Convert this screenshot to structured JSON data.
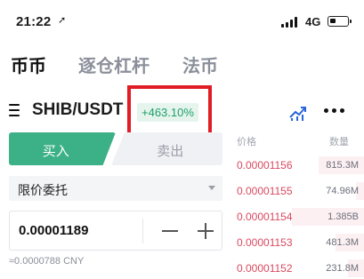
{
  "status_bar": {
    "time": "21:22",
    "location_arrow": "➚",
    "network": "4G"
  },
  "tabs": [
    {
      "label": "币币",
      "active": true
    },
    {
      "label": "逐仓杠杆",
      "active": false
    },
    {
      "label": "法币",
      "active": false
    }
  ],
  "pair": {
    "symbol": "SHIB/USDT",
    "change": "+463.10%",
    "change_color": "#1f9f6a"
  },
  "trade": {
    "buy_label": "买入",
    "sell_label": "卖出",
    "buy_color": "#3cb187",
    "order_type": "限价委托",
    "price_value": "0.00001189",
    "approx_value": "≈0.0000788 CNY"
  },
  "order_book": {
    "price_header": "价格",
    "qty_header": "数量",
    "ask_color": "#d9485f",
    "rows": [
      {
        "price": "0.00001156",
        "qty": "815.3M",
        "depth": 0.35
      },
      {
        "price": "0.00001155",
        "qty": "74.96M",
        "depth": 0.06
      },
      {
        "price": "0.00001154",
        "qty": "1.385B",
        "depth": 0.55
      },
      {
        "price": "0.00001153",
        "qty": "481.3M",
        "depth": 0.22
      },
      {
        "price": "0.00001152",
        "qty": "231.8M",
        "depth": 0.12
      }
    ]
  },
  "icons": [
    "location-arrow-icon",
    "signal-icon",
    "battery-icon",
    "menu-icon",
    "chart-icon",
    "more-icon",
    "caret-down-icon",
    "minus-icon",
    "plus-icon"
  ]
}
